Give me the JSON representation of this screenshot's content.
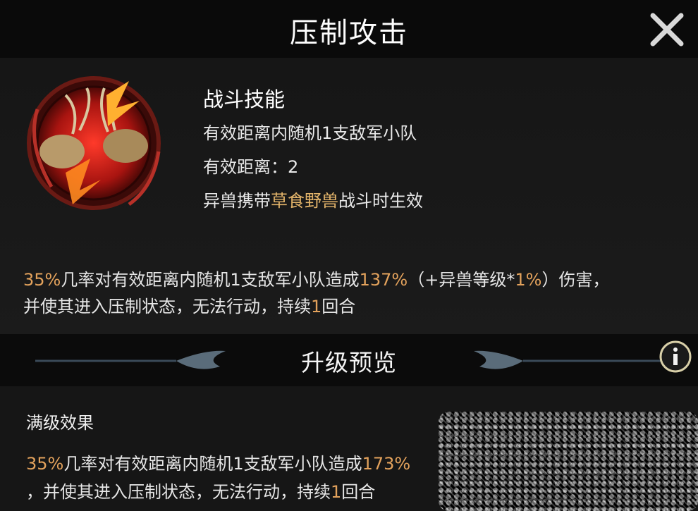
{
  "header": {
    "title": "压制攻击"
  },
  "skill": {
    "type": "战斗技能",
    "target": "有效距离内随机1支敌军小队",
    "range": "有效距离：2",
    "condition": {
      "prefix": "异兽携带",
      "highlight": "草食野兽",
      "suffix": "战斗时生效"
    },
    "description": {
      "p1": "35%",
      "t1": "几率对有效距离内随机1支敌军小队造成",
      "p2": "137%",
      "t2": "（+异兽等级*",
      "p3": "1%",
      "t3": "）伤害，",
      "t4": "并使其进入压制状态，无法行动，持续",
      "p4": "1",
      "t5": "回合"
    }
  },
  "upgrade": {
    "title": "升级预览"
  },
  "max_level": {
    "label": "满级效果",
    "p1": "35%",
    "t1": "几率对有效距离内随机1支敌军小队造成",
    "p2": "173%",
    "t2": "，并使其进入压制状态，无法行动，持续",
    "p3": "1",
    "t3": "回合"
  },
  "icons": {
    "close": "close-icon",
    "info": "info-icon",
    "skill": "stag-battle-skill-icon"
  },
  "colors": {
    "highlight": "#e3b46a",
    "number": "#e3a25c",
    "skill_red": "#c8201c"
  }
}
